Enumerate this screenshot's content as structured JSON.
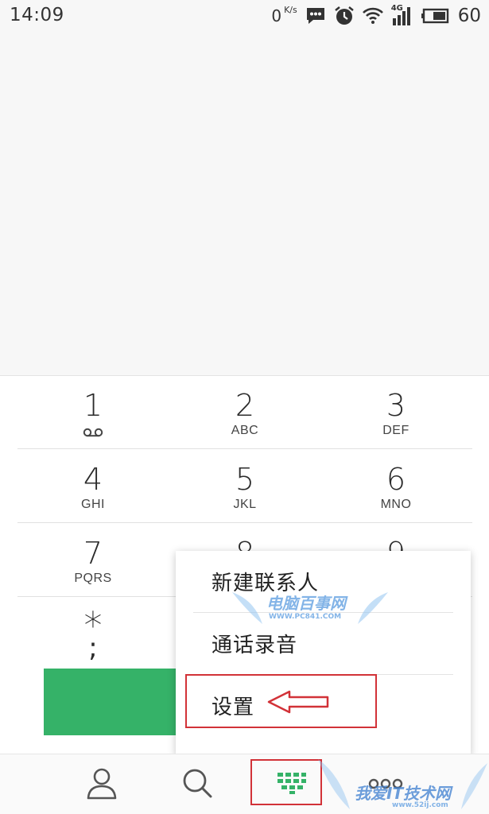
{
  "status_bar": {
    "time": "14:09",
    "net_speed": "0",
    "net_unit": "K/s",
    "network_type": "4G",
    "battery": "60",
    "icons": [
      "message-icon",
      "alarm-icon",
      "wifi-icon",
      "signal-icon",
      "battery-icon"
    ]
  },
  "keypad": {
    "keys": [
      {
        "digit": "1",
        "letters": "",
        "icon": "voicemail-icon"
      },
      {
        "digit": "2",
        "letters": "ABC"
      },
      {
        "digit": "3",
        "letters": "DEF"
      },
      {
        "digit": "4",
        "letters": "GHI"
      },
      {
        "digit": "5",
        "letters": "JKL"
      },
      {
        "digit": "6",
        "letters": "MNO"
      },
      {
        "digit": "7",
        "letters": "PQRS"
      },
      {
        "digit": "8",
        "letters": ""
      },
      {
        "digit": "9",
        "letters": ""
      },
      {
        "digit": "*",
        "letters": ";"
      }
    ]
  },
  "call_button": {
    "color": "#35b268"
  },
  "popup_menu": {
    "items": [
      {
        "label": "新建联系人"
      },
      {
        "label": "通话录音"
      },
      {
        "label": "设置"
      }
    ]
  },
  "bottom_nav": {
    "items": [
      {
        "name": "contacts",
        "icon": "person-icon"
      },
      {
        "name": "search",
        "icon": "search-icon"
      },
      {
        "name": "dialpad",
        "icon": "dialpad-icon",
        "active_color": "#35b268"
      },
      {
        "name": "more",
        "icon": "more-icon"
      }
    ]
  },
  "watermarks": {
    "mid_title": "电脑百事网",
    "mid_url": "WWW.PC841.COM",
    "bottom_title": "我爱IT技术网",
    "bottom_url": "www.52ij.com"
  },
  "annotation_color": "#d23238"
}
